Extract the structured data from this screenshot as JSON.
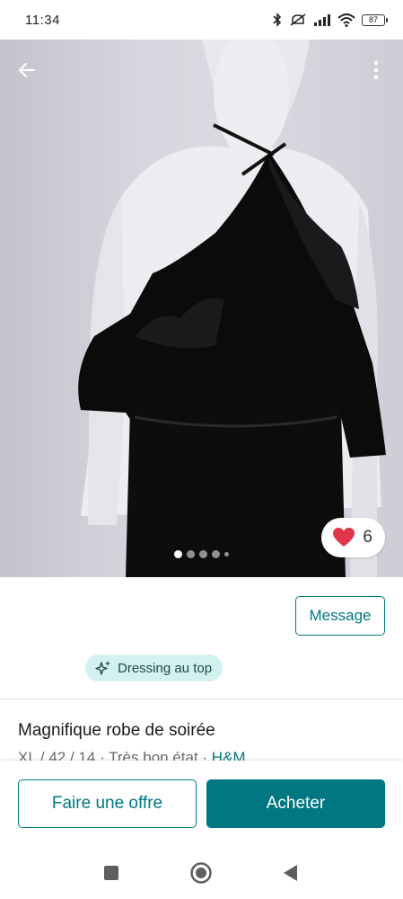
{
  "status_bar": {
    "time": "11:34",
    "battery": "87",
    "icons": [
      "bluetooth-icon",
      "mute-icon",
      "signal-icon",
      "wifi-icon",
      "battery-icon"
    ]
  },
  "toolbar": {
    "back_icon": "arrow-left-icon",
    "more_icon": "more-vertical-icon"
  },
  "gallery": {
    "total_dots": 5,
    "active_index": 0
  },
  "favorite": {
    "icon": "heart-icon",
    "count": "6",
    "color": "#e0354b"
  },
  "seller": {
    "message_label": "Message",
    "badge_icon": "sparkle-icon",
    "badge_label": "Dressing au top"
  },
  "item": {
    "title": "Magnifique robe de soirée",
    "size": "XL / 42 / 14",
    "separator": " · ",
    "condition": "Très bon état",
    "brand": "H&M"
  },
  "actions": {
    "offer_label": "Faire une offre",
    "buy_label": "Acheter"
  },
  "colors": {
    "accent": "#007782",
    "badge_bg": "#d3f1ee"
  },
  "system_nav": {
    "recents_icon": "square-icon",
    "home_icon": "circle-icon",
    "back_icon": "triangle-back-icon"
  }
}
